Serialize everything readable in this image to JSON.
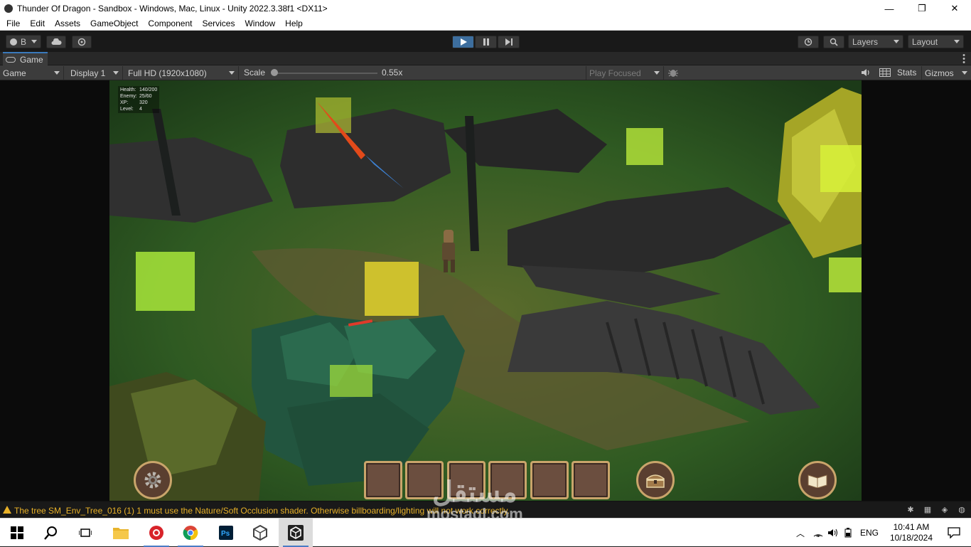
{
  "window": {
    "title": "Thunder Of Dragon - Sandbox - Windows, Mac, Linux - Unity 2022.3.38f1 <DX11>",
    "controls": [
      "—",
      "❐",
      "✕"
    ]
  },
  "menu": [
    "File",
    "Edit",
    "Assets",
    "GameObject",
    "Component",
    "Services",
    "Window",
    "Help"
  ],
  "toolbar": {
    "account_label": "B",
    "layers_label": "Layers",
    "layout_label": "Layout"
  },
  "tab": {
    "label": "Game"
  },
  "gamebar": {
    "mode": "Game",
    "display": "Display 1",
    "resolution": "Full HD (1920x1080)",
    "scale_label": "Scale",
    "scale_value": "0.55x",
    "play_focused": "Play Focused",
    "stats": "Stats",
    "gizmos": "Gizmos"
  },
  "hud": {
    "stats": [
      {
        "key": "Health:",
        "value": "140/200"
      },
      {
        "key": "Enemy:",
        "value": "25/60"
      },
      {
        "key": "XP:",
        "value": "320"
      },
      {
        "key": "Level:",
        "value": "4"
      }
    ],
    "inventory_slots": 6
  },
  "status": {
    "message": "The tree SM_Env_Tree_016 (1) 1 must use the Nature/Soft Occlusion shader. Otherwise billboarding/lighting will not work correctly."
  },
  "taskbar": {
    "language": "ENG",
    "time": "10:41 AM",
    "date": "10/18/2024"
  },
  "watermark": {
    "arabic": "مستقل",
    "latin": "mostaql.com"
  },
  "colors": {
    "accent_blue": "#3d6e9e",
    "warning": "#e8b128",
    "hud_gold": "#c9a56b"
  }
}
